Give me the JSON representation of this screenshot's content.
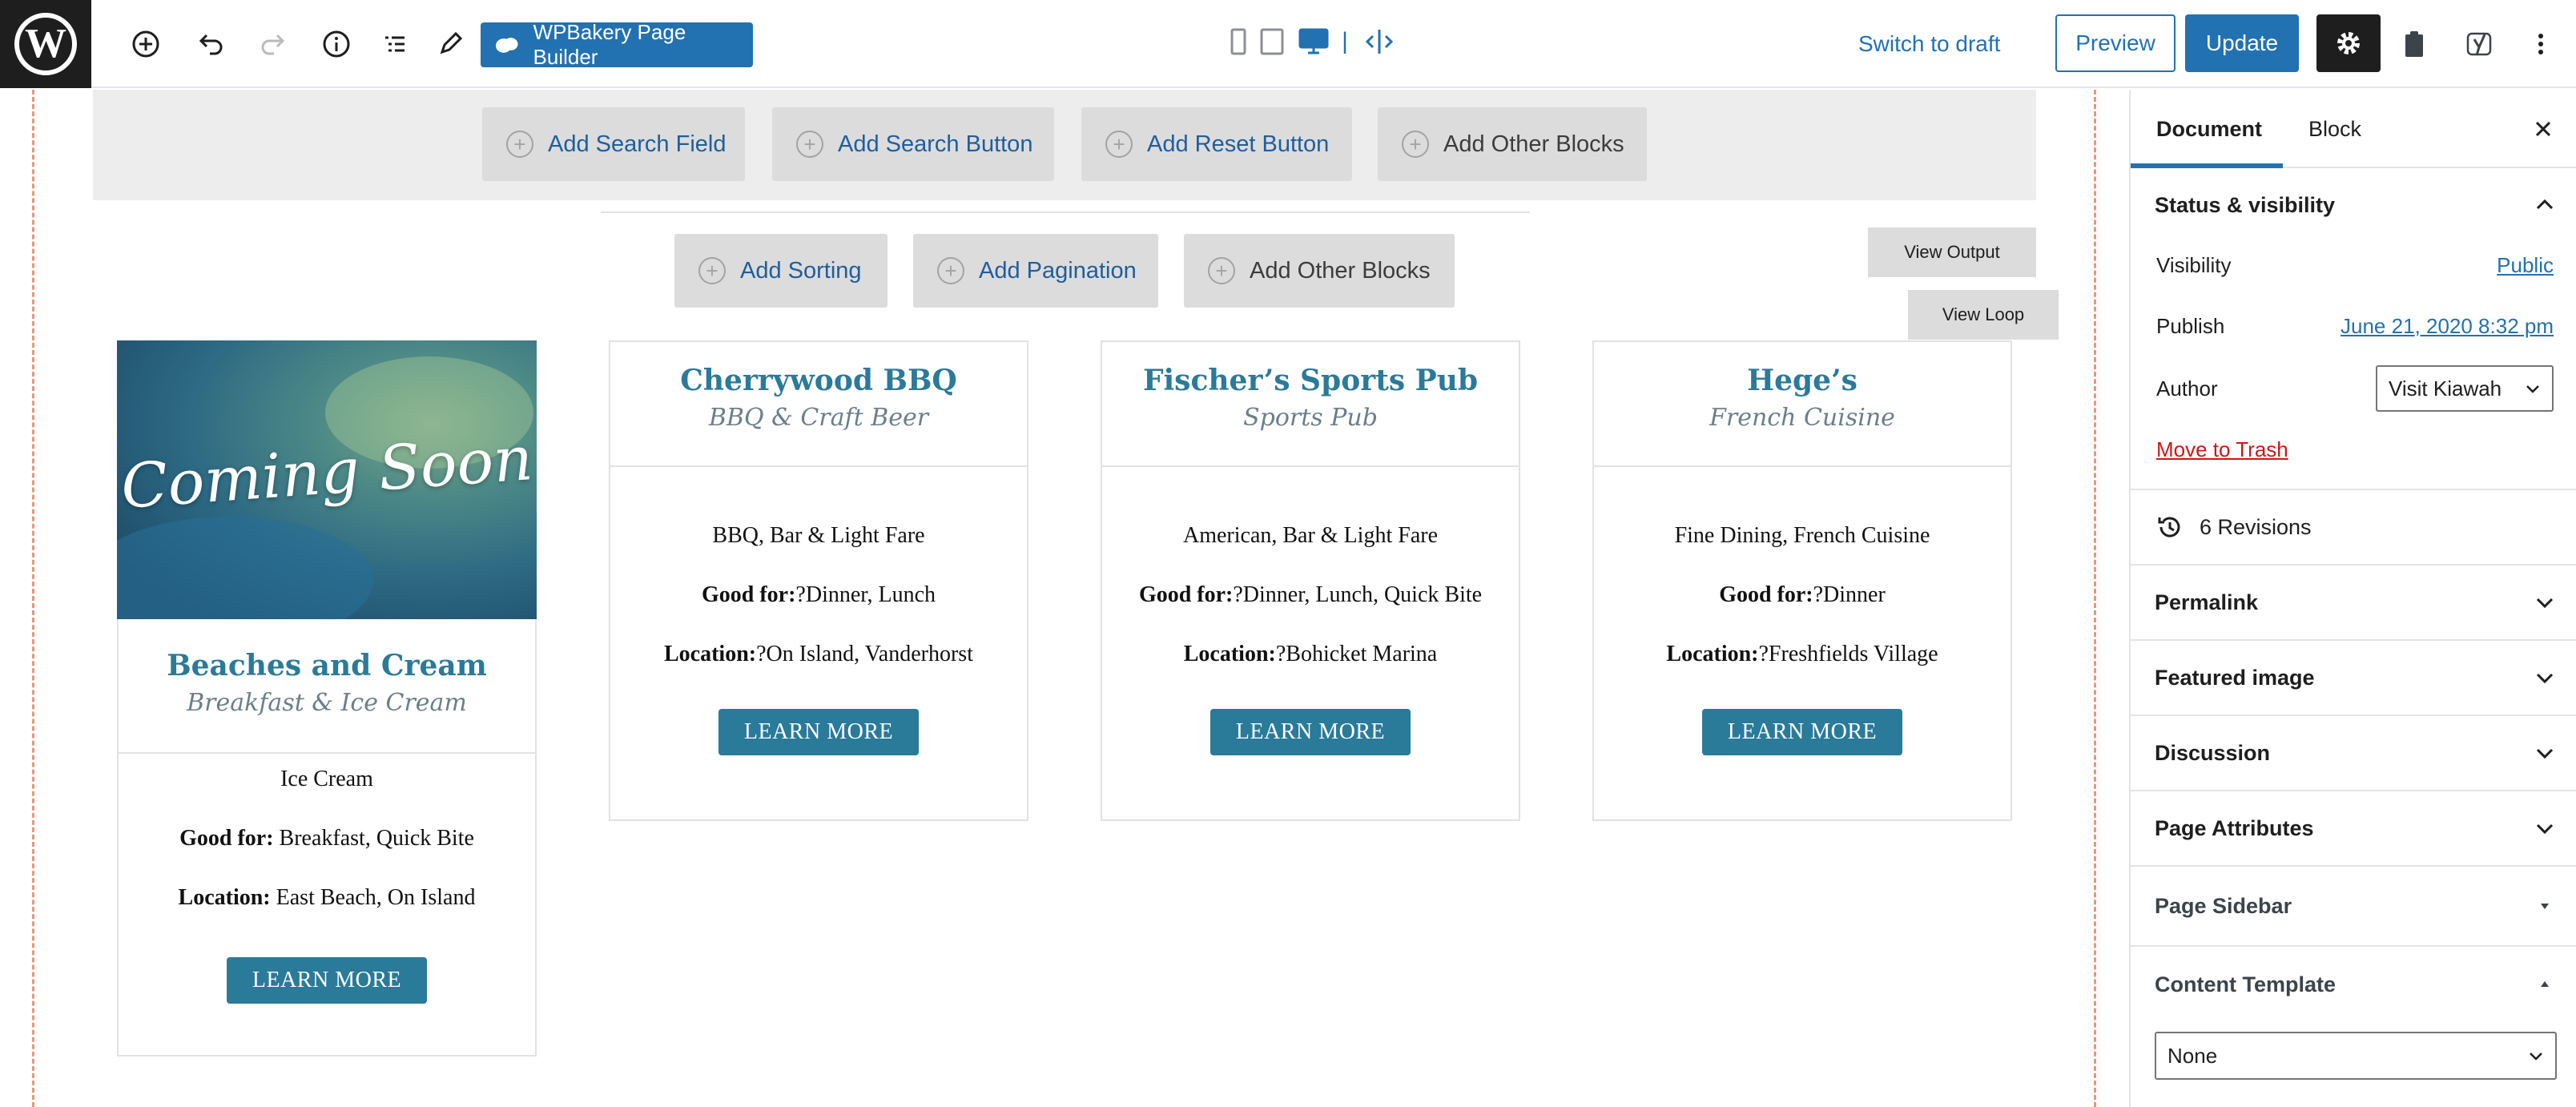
{
  "toolbar": {
    "wpbakery_label": "WPBakery Page Builder",
    "switch_to_draft": "Switch to draft",
    "preview": "Preview",
    "update": "Update",
    "device_separator": "|",
    "icons": [
      "wordpress-logo",
      "add-block-icon",
      "undo-icon",
      "redo-icon",
      "info-icon",
      "list-view-icon",
      "edit-pencil-icon",
      "mobile-icon",
      "tablet-icon",
      "desktop-icon",
      "responsive-icon",
      "gear-icon",
      "clipboard-icon",
      "yoast-icon",
      "more-vertical-icon"
    ]
  },
  "canvas": {
    "filter_blocks": [
      "Add Search Field",
      "Add Search Button",
      "Add Reset Button",
      "Add Other Blocks"
    ],
    "loop_blocks": [
      "Add Sorting",
      "Add Pagination",
      "Add Other Blocks"
    ],
    "view_output": "View Output",
    "view_loop": "View Loop",
    "cards": [
      {
        "image_text": "Coming Soon",
        "title": "Beaches and Cream",
        "subtitle": "Breakfast & Ice Cream",
        "category": "Ice Cream",
        "good_for_label": "Good for:",
        "good_for": " Breakfast, Quick Bite",
        "location_label": "Location:",
        "location": " East Beach, On Island",
        "button": "LEARN MORE"
      },
      {
        "title": "Cherrywood BBQ",
        "subtitle": "BBQ & Craft Beer",
        "category": "BBQ, Bar & Light Fare",
        "good_for_label": "Good for:",
        "good_for": "?Dinner, Lunch",
        "location_label": "Location:",
        "location": "?On Island, Vanderhorst",
        "button": "LEARN MORE"
      },
      {
        "title": "Fischer’s Sports Pub",
        "subtitle": "Sports Pub",
        "category": "American, Bar & Light Fare",
        "good_for_label": "Good for:",
        "good_for": "?Dinner, Lunch, Quick Bite",
        "location_label": "Location:",
        "location": "?Bohicket Marina",
        "button": "LEARN MORE"
      },
      {
        "title": "Hege’s",
        "subtitle": "French Cuisine",
        "category": "Fine Dining, French Cuisine",
        "good_for_label": "Good for:",
        "good_for": "?Dinner",
        "location_label": "Location:",
        "location": "?Freshfields Village",
        "button": "LEARN MORE"
      }
    ]
  },
  "sidebar": {
    "tabs": [
      "Document",
      "Block"
    ],
    "status_title": "Status & visibility",
    "visibility_label": "Visibility",
    "visibility_value": "Public",
    "publish_label": "Publish",
    "publish_value": "June 21, 2020 8:32 pm",
    "author_label": "Author",
    "author_value": "Visit Kiawah",
    "move_to_trash": "Move to Trash",
    "revisions": "6 Revisions",
    "panels": [
      "Permalink",
      "Featured image",
      "Discussion",
      "Page Attributes",
      "Page Sidebar",
      "Content Template"
    ],
    "content_template_value": "None"
  },
  "colors": {
    "accent": "#2271b1",
    "card_accent": "#2a7a9a",
    "trash": "#cc1818",
    "guide_line": "#e9967a"
  }
}
